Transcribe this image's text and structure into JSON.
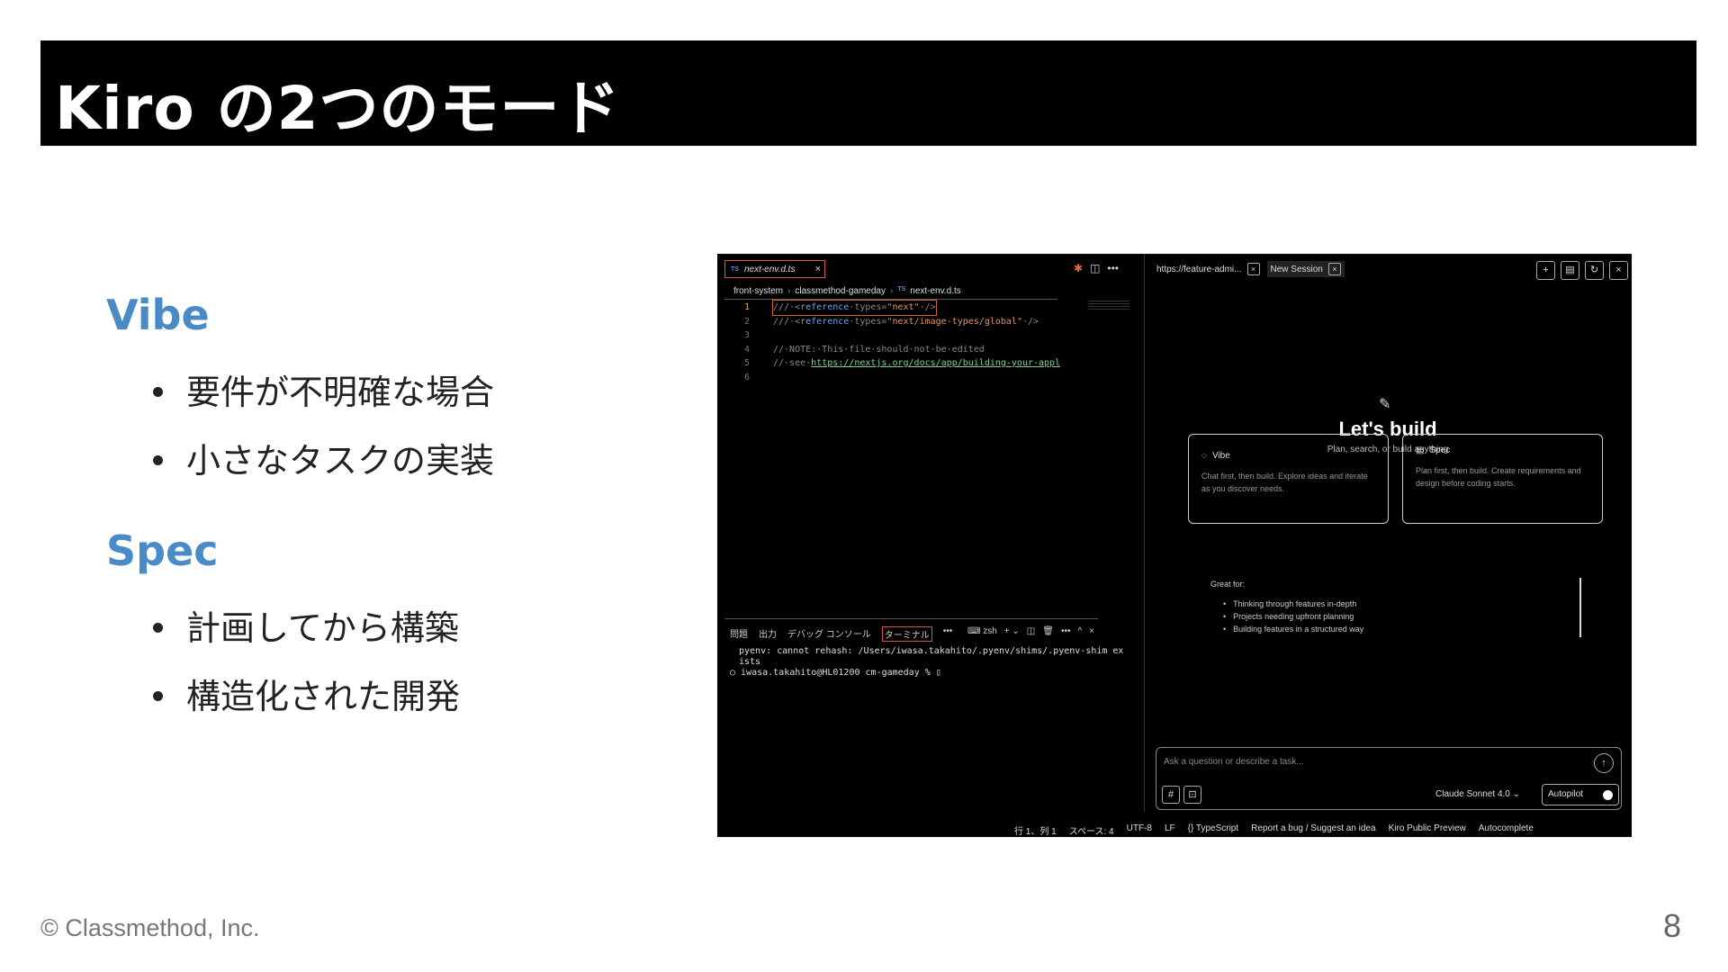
{
  "slide": {
    "title": "Kiro の2つのモード",
    "footer": "© Classmethod, Inc.",
    "page_number": "8",
    "accent_color": "#4a8bc7",
    "sections": [
      {
        "heading": "Vibe",
        "bullets": [
          "要件が不明確な場合",
          "小さなタスクの実装"
        ]
      },
      {
        "heading": "Spec",
        "bullets": [
          "計画してから構築",
          "構造化された開発"
        ]
      }
    ]
  },
  "editor": {
    "tab_label": "next-env.d.ts",
    "tab_badge": "TS",
    "tab_close": "×",
    "breadcrumb": [
      "front-system",
      "classmethod-gameday",
      "next-env.d.ts"
    ],
    "breadcrumb_sep": "›",
    "actions": [
      "✱",
      "◫",
      "•••"
    ],
    "code_lines": [
      {
        "n": "1",
        "parts": [
          {
            "t": "///·<",
            "c": "c-com"
          },
          {
            "t": "reference",
            "c": "c-kw"
          },
          {
            "t": "·types=",
            "c": "c-com"
          },
          {
            "t": "\"next\"",
            "c": "c-str"
          },
          {
            "t": "·/>",
            "c": "c-com"
          }
        ]
      },
      {
        "n": "2",
        "parts": [
          {
            "t": "///·<",
            "c": "c-com"
          },
          {
            "t": "reference",
            "c": "c-kw"
          },
          {
            "t": "·types=",
            "c": "c-com"
          },
          {
            "t": "\"next/image-types/global\"",
            "c": "c-str"
          },
          {
            "t": "·/>",
            "c": "c-com"
          }
        ]
      },
      {
        "n": "3",
        "parts": []
      },
      {
        "n": "4",
        "parts": [
          {
            "t": "//·NOTE:·This·file·should·not·be·edited",
            "c": "c-com"
          }
        ]
      },
      {
        "n": "5",
        "parts": [
          {
            "t": "//·see·",
            "c": "c-com"
          },
          {
            "t": "https://nextjs.org/docs/app/building-your-appl",
            "c": "c-link"
          }
        ]
      },
      {
        "n": "6",
        "parts": []
      }
    ]
  },
  "panel": {
    "tabs": [
      "問題",
      "出力",
      "デバッグ コンソール",
      "ターミナル",
      "•••"
    ],
    "active_tab": 3,
    "shell": "zsh",
    "actions": [
      "+ ⌄",
      "◫",
      "🗑",
      "•••",
      "^",
      "×"
    ],
    "terminal_lines": [
      "pyenv: cannot rehash: /Users/iwasa.takahito/.pyenv/shims/.pyenv-shim ex",
      "ists",
      "○ iwasa.takahito@HL01200 cm-gameday % ▯"
    ]
  },
  "chat": {
    "tabs": [
      {
        "label": "https://feature-admi...",
        "close": "×"
      },
      {
        "label": "New Session",
        "close": "×"
      }
    ],
    "toolbar": [
      "+",
      "▤",
      "↻",
      "×"
    ],
    "icon": "magic-wand-icon",
    "heading": "Let's build",
    "subheading": "Plan, search, or build anything",
    "modes": [
      {
        "title": "Vibe",
        "desc": "Chat first, then build. Explore ideas and iterate as you discover needs."
      },
      {
        "title": "Spec",
        "desc": "Plan first, then build. Create requirements and design before coding starts."
      }
    ],
    "great_for_label": "Great for:",
    "great_for": [
      "Thinking through features in-depth",
      "Projects needing upfront planning",
      "Building features in a structured way"
    ],
    "input_placeholder": "Ask a question or describe a task...",
    "model": "Claude Sonnet 4.0 ⌄",
    "autopilot": "Autopilot"
  },
  "status_bar": [
    "行 1、列 1",
    "スペース: 4",
    "UTF-8",
    "LF",
    "{} TypeScript",
    "Report a bug / Suggest an idea",
    "Kiro Public Preview",
    "Autocomplete"
  ]
}
